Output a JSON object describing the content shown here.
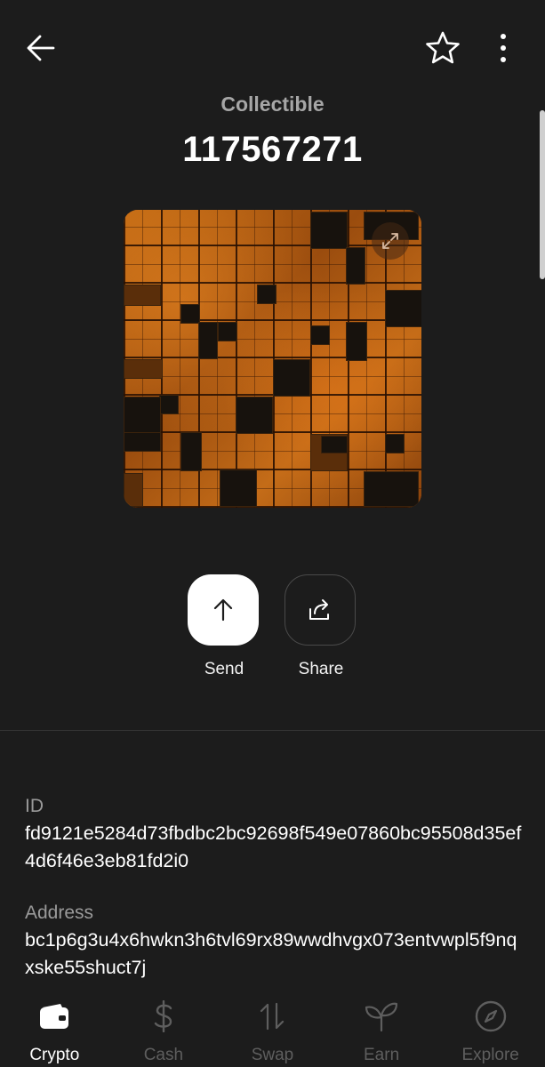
{
  "header": {
    "subtitle": "Collectible",
    "title": "117567271"
  },
  "actions": {
    "send_label": "Send",
    "share_label": "Share"
  },
  "details": {
    "id_label": "ID",
    "id_value": "fd9121e5284d73fbdbc2bc92698f549e07860bc95508d35ef4d6f46e3eb81fd2i0",
    "address_label": "Address",
    "address_value": "bc1p6g3u4x6hwkn3h6tvl69rx89wwdhvgx073entvwpl5f9nqxske55shuct7j"
  },
  "nav": {
    "items": [
      {
        "label": "Crypto",
        "icon": "wallet-icon",
        "active": true
      },
      {
        "label": "Cash",
        "icon": "dollar-icon",
        "active": false
      },
      {
        "label": "Swap",
        "icon": "swap-icon",
        "active": false
      },
      {
        "label": "Earn",
        "icon": "sprout-icon",
        "active": false
      },
      {
        "label": "Explore",
        "icon": "compass-icon",
        "active": false
      }
    ]
  },
  "colors": {
    "background": "#1c1c1c",
    "primary_text": "#ffffff",
    "secondary_text": "#9a9a9a",
    "inactive_nav": "#5e5e5e",
    "artwork_orange": "#b05a13"
  }
}
